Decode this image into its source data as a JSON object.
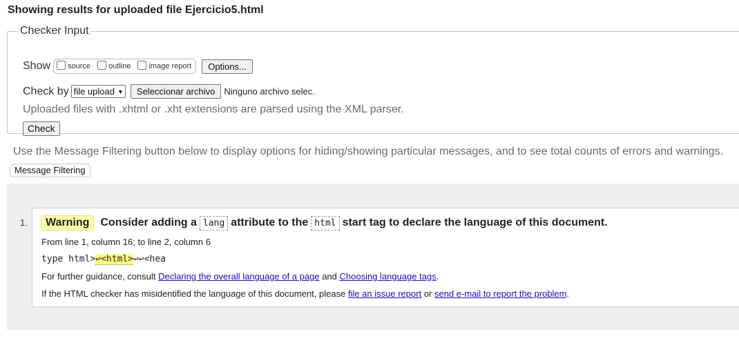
{
  "heading": "Showing results for uploaded file Ejercicio5.html",
  "checker": {
    "legend": "Checker Input",
    "show_label": "Show",
    "options": [
      "source",
      "outline",
      "image report"
    ],
    "options_button": "Options...",
    "checkby_label": "Check by",
    "checkby_selected": "file upload",
    "choose_file_button": "Seleccionar archivo",
    "no_file": "Ninguno archivo selec.",
    "note": "Uploaded files with .xhtml or .xht extensions are parsed using the XML parser.",
    "check_button": "Check"
  },
  "filter_note": "Use the Message Filtering button below to display options for hiding/showing particular messages, and to see total counts of errors and warnings.",
  "filter_button": "Message Filtering",
  "message": {
    "number": "1.",
    "badge": "Warning",
    "text_1": "Consider adding a",
    "code_1": "lang",
    "text_2": "attribute to the",
    "code_2": "html",
    "text_3": "start tag to declare the language of this document.",
    "location": "From line 1, column 16; to line 2, column 6",
    "extract_before": "type html>",
    "extract_highlight": "↩<html>",
    "extract_after": "↩↩<hea",
    "guide_prefix": "For further guidance, consult",
    "guide_link_1": "Declaring the overall language of a page",
    "guide_and": "and",
    "guide_link_2": "Choosing language tags",
    "guide_suffix": ".",
    "mis_prefix": "If the HTML checker has misidentified the language of this document, please",
    "mis_link_1": "file an issue report",
    "mis_or": "or",
    "mis_link_2": "send e-mail to report the problem",
    "mis_suffix": "."
  }
}
